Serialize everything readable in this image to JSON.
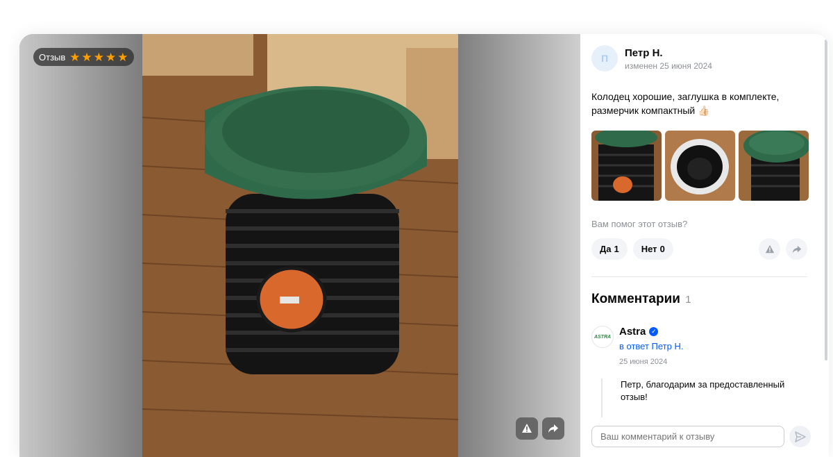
{
  "badge": {
    "label": "Отзыв",
    "rating": 5
  },
  "author": {
    "initial": "П",
    "name": "Петр Н.",
    "date": "изменен 25 июня 2024"
  },
  "review": {
    "text": "Колодец хорошие, заглушка в комплекте, размерчик компактный 👍🏻"
  },
  "thumbnails": [
    "photo-top-green",
    "photo-inside",
    "photo-lid"
  ],
  "helpful": {
    "question": "Вам помог этот отзыв?",
    "yes_label": "Да",
    "yes_count": "1",
    "no_label": "Нет",
    "no_count": "0"
  },
  "comments": {
    "title": "Комментарии",
    "count": "1",
    "items": [
      {
        "brand_logo": "ASTRA",
        "author": "Astra",
        "in_reply": "в ответ Петр Н.",
        "date": "25 июня 2024",
        "text": "Петр, благодарим за предоставленный отзыв!"
      }
    ]
  },
  "comment_input": {
    "placeholder": "Ваш комментарий к отзыву"
  },
  "icons": {
    "report": "warning-icon",
    "share": "share-arrow-icon",
    "send": "send-icon",
    "verified": "verified-check-icon",
    "star": "star-icon"
  },
  "colors": {
    "accent_blue": "#005bff",
    "star_orange": "#ff9f00",
    "well_lid_green": "#2f6b4a"
  }
}
